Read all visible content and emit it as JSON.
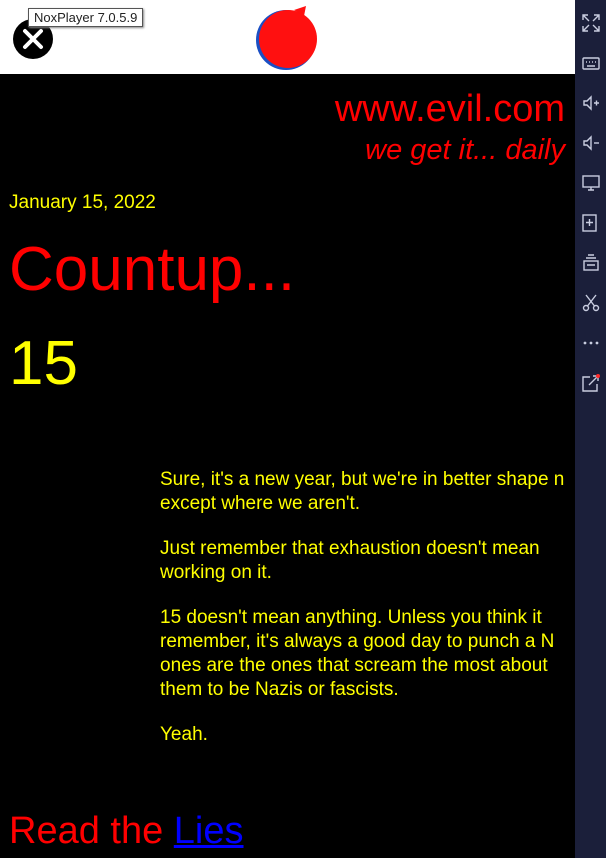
{
  "window": {
    "title": "NoxPlayer 7.0.5.9"
  },
  "site": {
    "name": "www.evil.com",
    "tagline": "we get it... daily"
  },
  "post": {
    "date": "January 15, 2022",
    "title": "Countup...",
    "number": "15",
    "paragraphs": [
      "Sure, it's a new year, but we're in better shape n",
      "except where we aren't.",
      "Just remember that exhaustion doesn't mean",
      "working on it.",
      "15 doesn't mean anything. Unless you think it",
      "remember, it's always a good day to punch a N",
      "ones are the ones that scream the most about",
      "them to be Nazis or fascists.",
      "Yeah."
    ]
  },
  "footer": {
    "read_prefix": "Read the ",
    "read_link": "Lies"
  },
  "sidebar": {
    "icons": [
      "fullscreen-icon",
      "keyboard-icon",
      "volume-up-icon",
      "volume-down-icon",
      "screen-icon",
      "apk-install-icon",
      "multi-instance-icon",
      "scissors-icon",
      "more-icon",
      "share-icon"
    ]
  },
  "colors": {
    "accent_red": "#ff0000",
    "text_yellow": "#ffff00",
    "link_blue": "#0000ff",
    "sidebar_bg": "#1b1f3a"
  }
}
